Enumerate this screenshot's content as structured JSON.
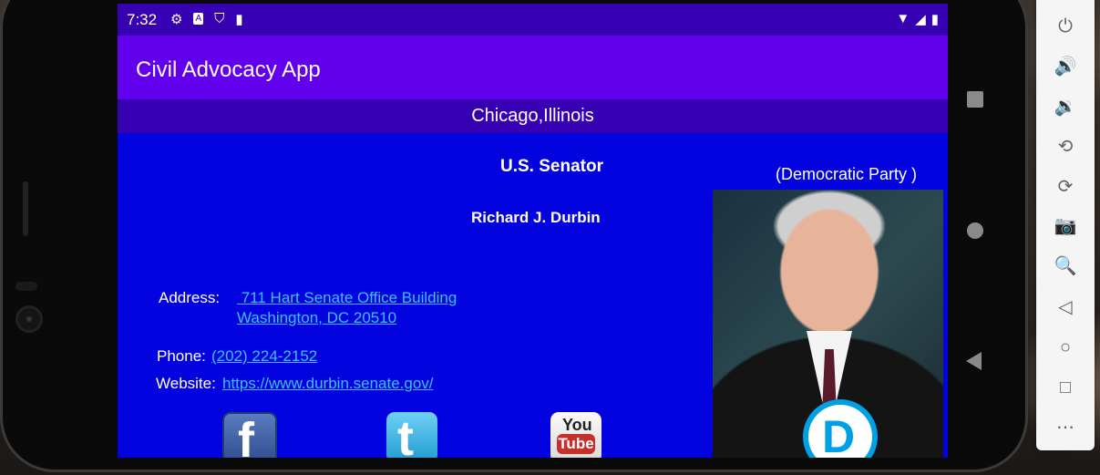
{
  "status": {
    "time": "7:32",
    "left_icons": [
      "gear-icon",
      "a-icon",
      "shield-icon",
      "sd-card-icon"
    ],
    "right_icons": [
      "wifi-icon",
      "signal-icon",
      "battery-icon"
    ]
  },
  "app": {
    "title": "Civil Advocacy App"
  },
  "location": "Chicago,Illinois",
  "official": {
    "office": "U.S. Senator",
    "party": "(Democratic Party )",
    "name": "Richard J. Durbin",
    "address_label": "Address:",
    "address_line1": " 711 Hart Senate Office Building",
    "address_line2": "Washington, DC 20510",
    "phone_label": "Phone:",
    "phone": "(202) 224-2152",
    "website_label": "Website:",
    "website": "https://www.durbin.senate.gov/"
  },
  "social": {
    "facebook_glyph": "f",
    "twitter_glyph": "t",
    "youtube_you": "You",
    "youtube_tube": "Tube"
  },
  "party_logo_glyph": "D",
  "emulator_toolbar": [
    "power-icon",
    "volume-up-icon",
    "volume-down-icon",
    "rotate-left-icon",
    "rotate-right-icon",
    "camera-icon",
    "zoom-icon",
    "back-icon",
    "home-icon",
    "overview-icon",
    "more-icon"
  ],
  "colors": {
    "status_bar": "#3700b3",
    "app_bar": "#6200ee",
    "background": "#0303e0",
    "link": "#3ec1f5",
    "democratic_blue": "#00a0e4"
  }
}
